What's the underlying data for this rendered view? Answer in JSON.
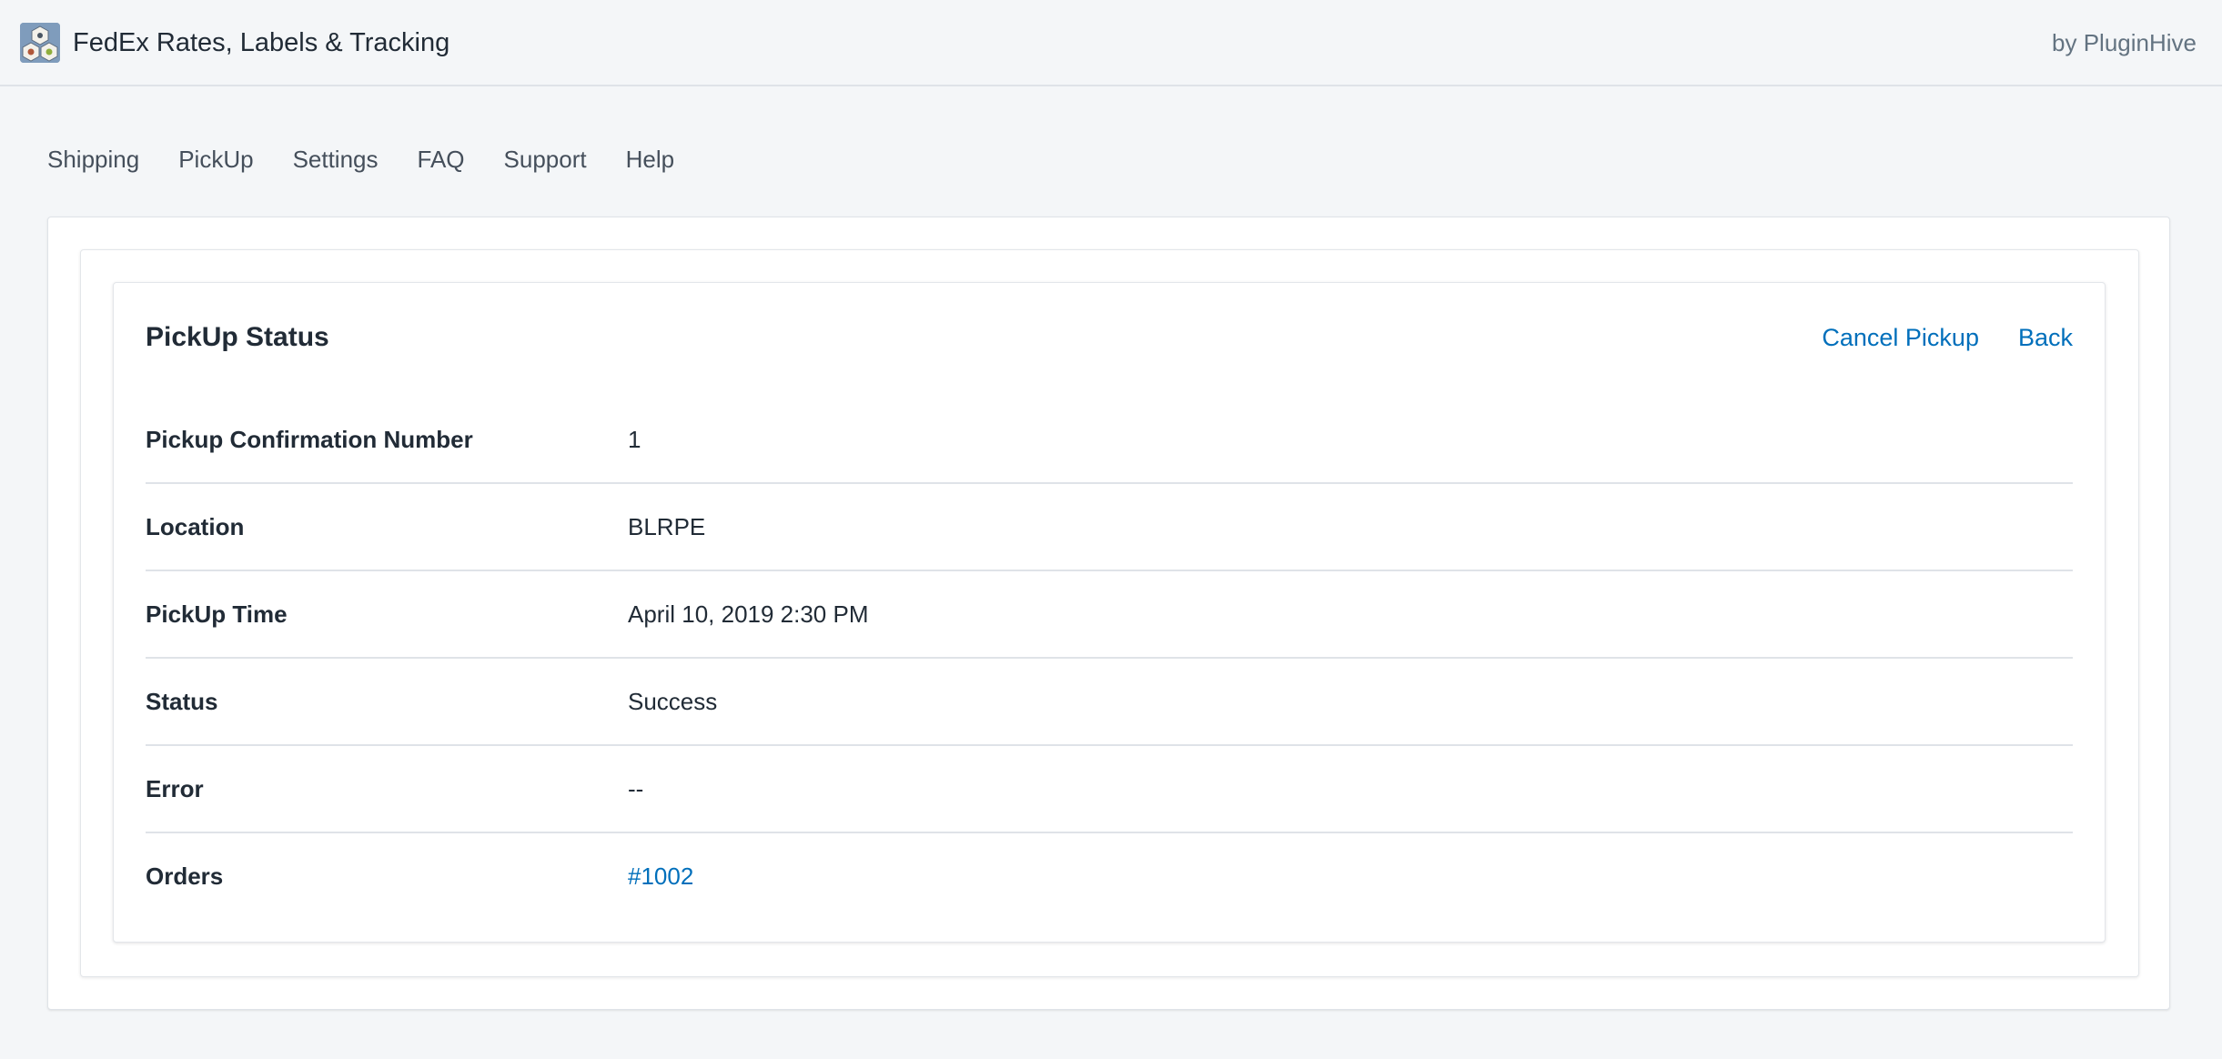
{
  "header": {
    "app_title": "FedEx Rates, Labels & Tracking",
    "byline": "by PluginHive",
    "logo_icon": "app-logo-icon"
  },
  "nav": {
    "items": [
      {
        "label": "Shipping"
      },
      {
        "label": "PickUp"
      },
      {
        "label": "Settings"
      },
      {
        "label": "FAQ"
      },
      {
        "label": "Support"
      },
      {
        "label": "Help"
      }
    ]
  },
  "pickup_status": {
    "title": "PickUp Status",
    "actions": {
      "cancel_label": "Cancel Pickup",
      "back_label": "Back"
    },
    "rows": [
      {
        "label": "Pickup Confirmation Number",
        "value": "1"
      },
      {
        "label": "Location",
        "value": "BLRPE"
      },
      {
        "label": "PickUp Time",
        "value": "April 10, 2019 2:30 PM"
      },
      {
        "label": "Status",
        "value": "Success"
      },
      {
        "label": "Error",
        "value": "--"
      },
      {
        "label": "Orders",
        "value": "#1002"
      }
    ]
  },
  "colors": {
    "background": "#f4f6f8",
    "link": "#006fbb",
    "text": "#212b36",
    "muted": "#637381"
  }
}
